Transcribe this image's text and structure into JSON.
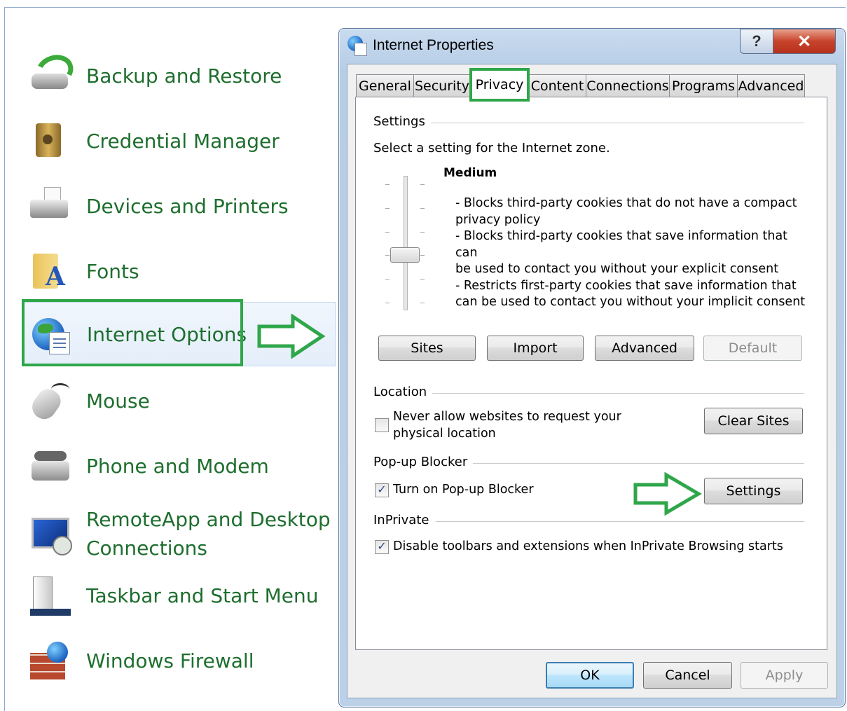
{
  "control_panel": {
    "items": [
      {
        "label": "Backup and Restore",
        "icon": "backup-icon"
      },
      {
        "label": "Credential Manager",
        "icon": "credential-manager-icon"
      },
      {
        "label": "Devices and Printers",
        "icon": "printer-icon"
      },
      {
        "label": "Fonts",
        "icon": "fonts-folder-icon"
      },
      {
        "label": "Internet Options",
        "icon": "internet-options-icon"
      },
      {
        "label": "Mouse",
        "icon": "mouse-icon"
      },
      {
        "label": "Phone and Modem",
        "icon": "phone-icon"
      },
      {
        "label": "RemoteApp and Desktop",
        "label2": "Connections",
        "icon": "remote-desktop-icon"
      },
      {
        "label": "Taskbar and Start Menu",
        "icon": "taskbar-icon"
      },
      {
        "label": "Windows Firewall",
        "icon": "firewall-icon"
      }
    ],
    "highlight_color": "#2fa64a",
    "label_color": "#1e6e2e"
  },
  "dialog": {
    "title": "Internet Properties",
    "help_label": "?",
    "close_label": "✕",
    "tabs": [
      "General",
      "Security",
      "Privacy",
      "Content",
      "Connections",
      "Programs",
      "Advanced"
    ],
    "active_tab": "Privacy",
    "settings": {
      "group_label": "Settings",
      "prompt": "Select a setting for the Internet zone.",
      "level": "Medium",
      "description": "- Blocks third-party cookies that do not have a compact\nprivacy policy\n- Blocks third-party cookies that save information that can\nbe used to contact you without your explicit consent\n- Restricts first-party cookies that save information that\ncan be used to contact you without your implicit consent",
      "buttons": {
        "sites": "Sites",
        "import": "Import",
        "advanced": "Advanced",
        "default": "Default"
      }
    },
    "location": {
      "group_label": "Location",
      "checkbox_label_1": "Never allow websites to request your",
      "checkbox_label_2": "physical location",
      "checked": false,
      "clear_sites": "Clear Sites"
    },
    "popup": {
      "group_label": "Pop-up Blocker",
      "checkbox_label": "Turn on Pop-up Blocker",
      "checked": true,
      "settings_button": "Settings"
    },
    "inprivate": {
      "group_label": "InPrivate",
      "checkbox_label": "Disable toolbars and extensions when InPrivate Browsing starts",
      "checked": true
    },
    "footer": {
      "ok": "OK",
      "cancel": "Cancel",
      "apply": "Apply"
    },
    "check_mark": "✓"
  }
}
